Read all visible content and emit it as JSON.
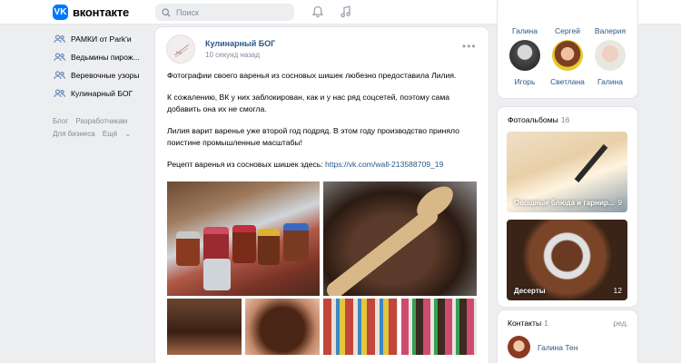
{
  "header": {
    "logo_mark": "VK",
    "logo_text": "вконтакте",
    "search_placeholder": "Поиск",
    "bell_icon": "bell-icon",
    "music_icon": "music-icon",
    "apps_icon": "apps-grid-icon"
  },
  "leftnav": {
    "items": [
      {
        "label": "РАМКИ от Park'и",
        "icon": "users-icon"
      },
      {
        "label": "Ведьмины пирож...",
        "icon": "users-icon"
      },
      {
        "label": "Веревочные узоры",
        "icon": "users-icon"
      },
      {
        "label": "Кулинарный БОГ",
        "icon": "users-icon"
      }
    ],
    "footer": [
      "Блог",
      "Разработчикам",
      "Для бизнеса",
      "Ещё"
    ]
  },
  "post": {
    "author": "Кулинарный БОГ",
    "time": "10 секунд назад",
    "more": "•••",
    "paragraphs": [
      "Фотографии своего варенья из сосновых шишек любезно предоставила Лилия.",
      "К сожалению, ВК у них заблокирован, как и у нас ряд соцсетей, поэтому сама добавить она их не смогла.",
      "Лилия варит варенье уже второй год подряд. В этом году производство приняло поистине промышленные масштабы!"
    ],
    "recipe_label": "Рецепт варенья из сосновых шишек здесь: ",
    "recipe_link": "https://vk.com/wall-213588709_19"
  },
  "friends": {
    "top_names": [
      "Галина",
      "Сергей",
      "Валерия"
    ],
    "names": [
      "Игорь",
      "Светлана",
      "Галина"
    ]
  },
  "albums": {
    "title": "Фотоальбомы",
    "count": "16",
    "items": [
      {
        "caption": "Овощные блюда и гарнир...",
        "count": "9"
      },
      {
        "caption": "Десерты",
        "count": "12"
      }
    ]
  },
  "contacts": {
    "title": "Контакты",
    "count": "1",
    "edit": "ред.",
    "name": "Галина Тен"
  },
  "colors": {
    "accent": "#0077ff",
    "link": "#2a5885",
    "muted": "#818c99",
    "bg": "#edeef0"
  }
}
